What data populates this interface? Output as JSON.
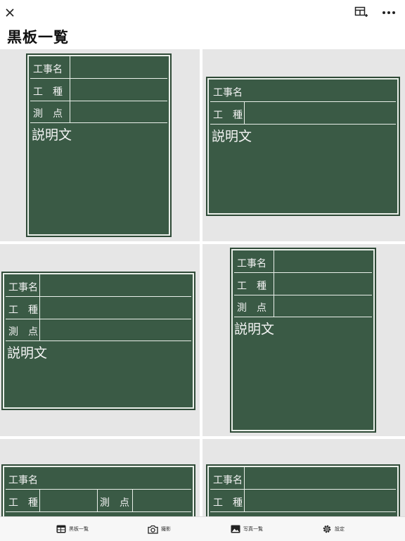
{
  "header": {
    "title": "黒板一覧"
  },
  "board": {
    "work_name": "工事名",
    "work_type": "工　種",
    "point": "測　点",
    "description": "説明文"
  },
  "tabs": [
    {
      "label": "黒板一覧",
      "icon": "board-list-icon"
    },
    {
      "label": "撮影",
      "icon": "camera-icon"
    },
    {
      "label": "写真一覧",
      "icon": "photo-list-icon"
    },
    {
      "label": "設定",
      "icon": "gear-icon"
    }
  ],
  "colors": {
    "board_green": "#3a5a45",
    "board_line": "#e9efe9",
    "cell_bg": "#e6e6e6"
  }
}
